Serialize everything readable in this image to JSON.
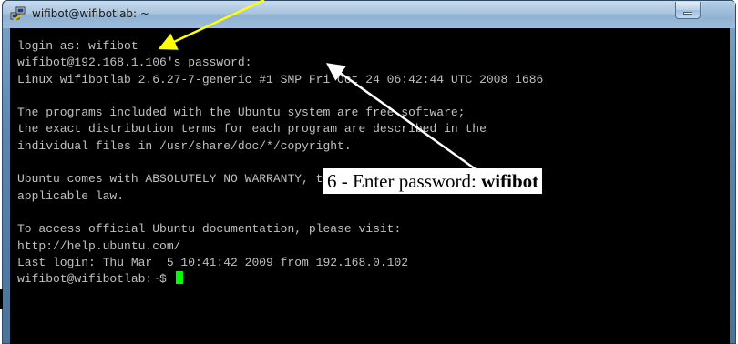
{
  "window": {
    "title": "wifibot@wifibotlab: ~",
    "icon": "putty-icon"
  },
  "terminal": {
    "lines": [
      "login as: wifibot",
      "wifibot@192.168.1.106's password:",
      "Linux wifibotlab 2.6.27-7-generic #1 SMP Fri Oct 24 06:42:44 UTC 2008 i686",
      "",
      "The programs included with the Ubuntu system are free software;",
      "the exact distribution terms for each program are described in the",
      "individual files in /usr/share/doc/*/copyright.",
      "",
      "Ubuntu comes with ABSOLUTELY NO WARRANTY, to the extent permitted by",
      "applicable law.",
      "",
      "To access official Ubuntu documentation, please visit:",
      "http://help.ubuntu.com/",
      "Last login: Thu Mar  5 10:41:42 2009 from 192.168.0.102"
    ],
    "prompt": "wifibot@wifibotlab:~$ "
  },
  "annotation": {
    "step_text": "6 - Enter password: ",
    "password": "wifibot"
  },
  "colors": {
    "terminal_bg": "#000000",
    "terminal_text": "#c0c0c0",
    "cursor": "#00ff00",
    "arrow_yellow": "#ffff00",
    "arrow_white": "#ffffff"
  }
}
